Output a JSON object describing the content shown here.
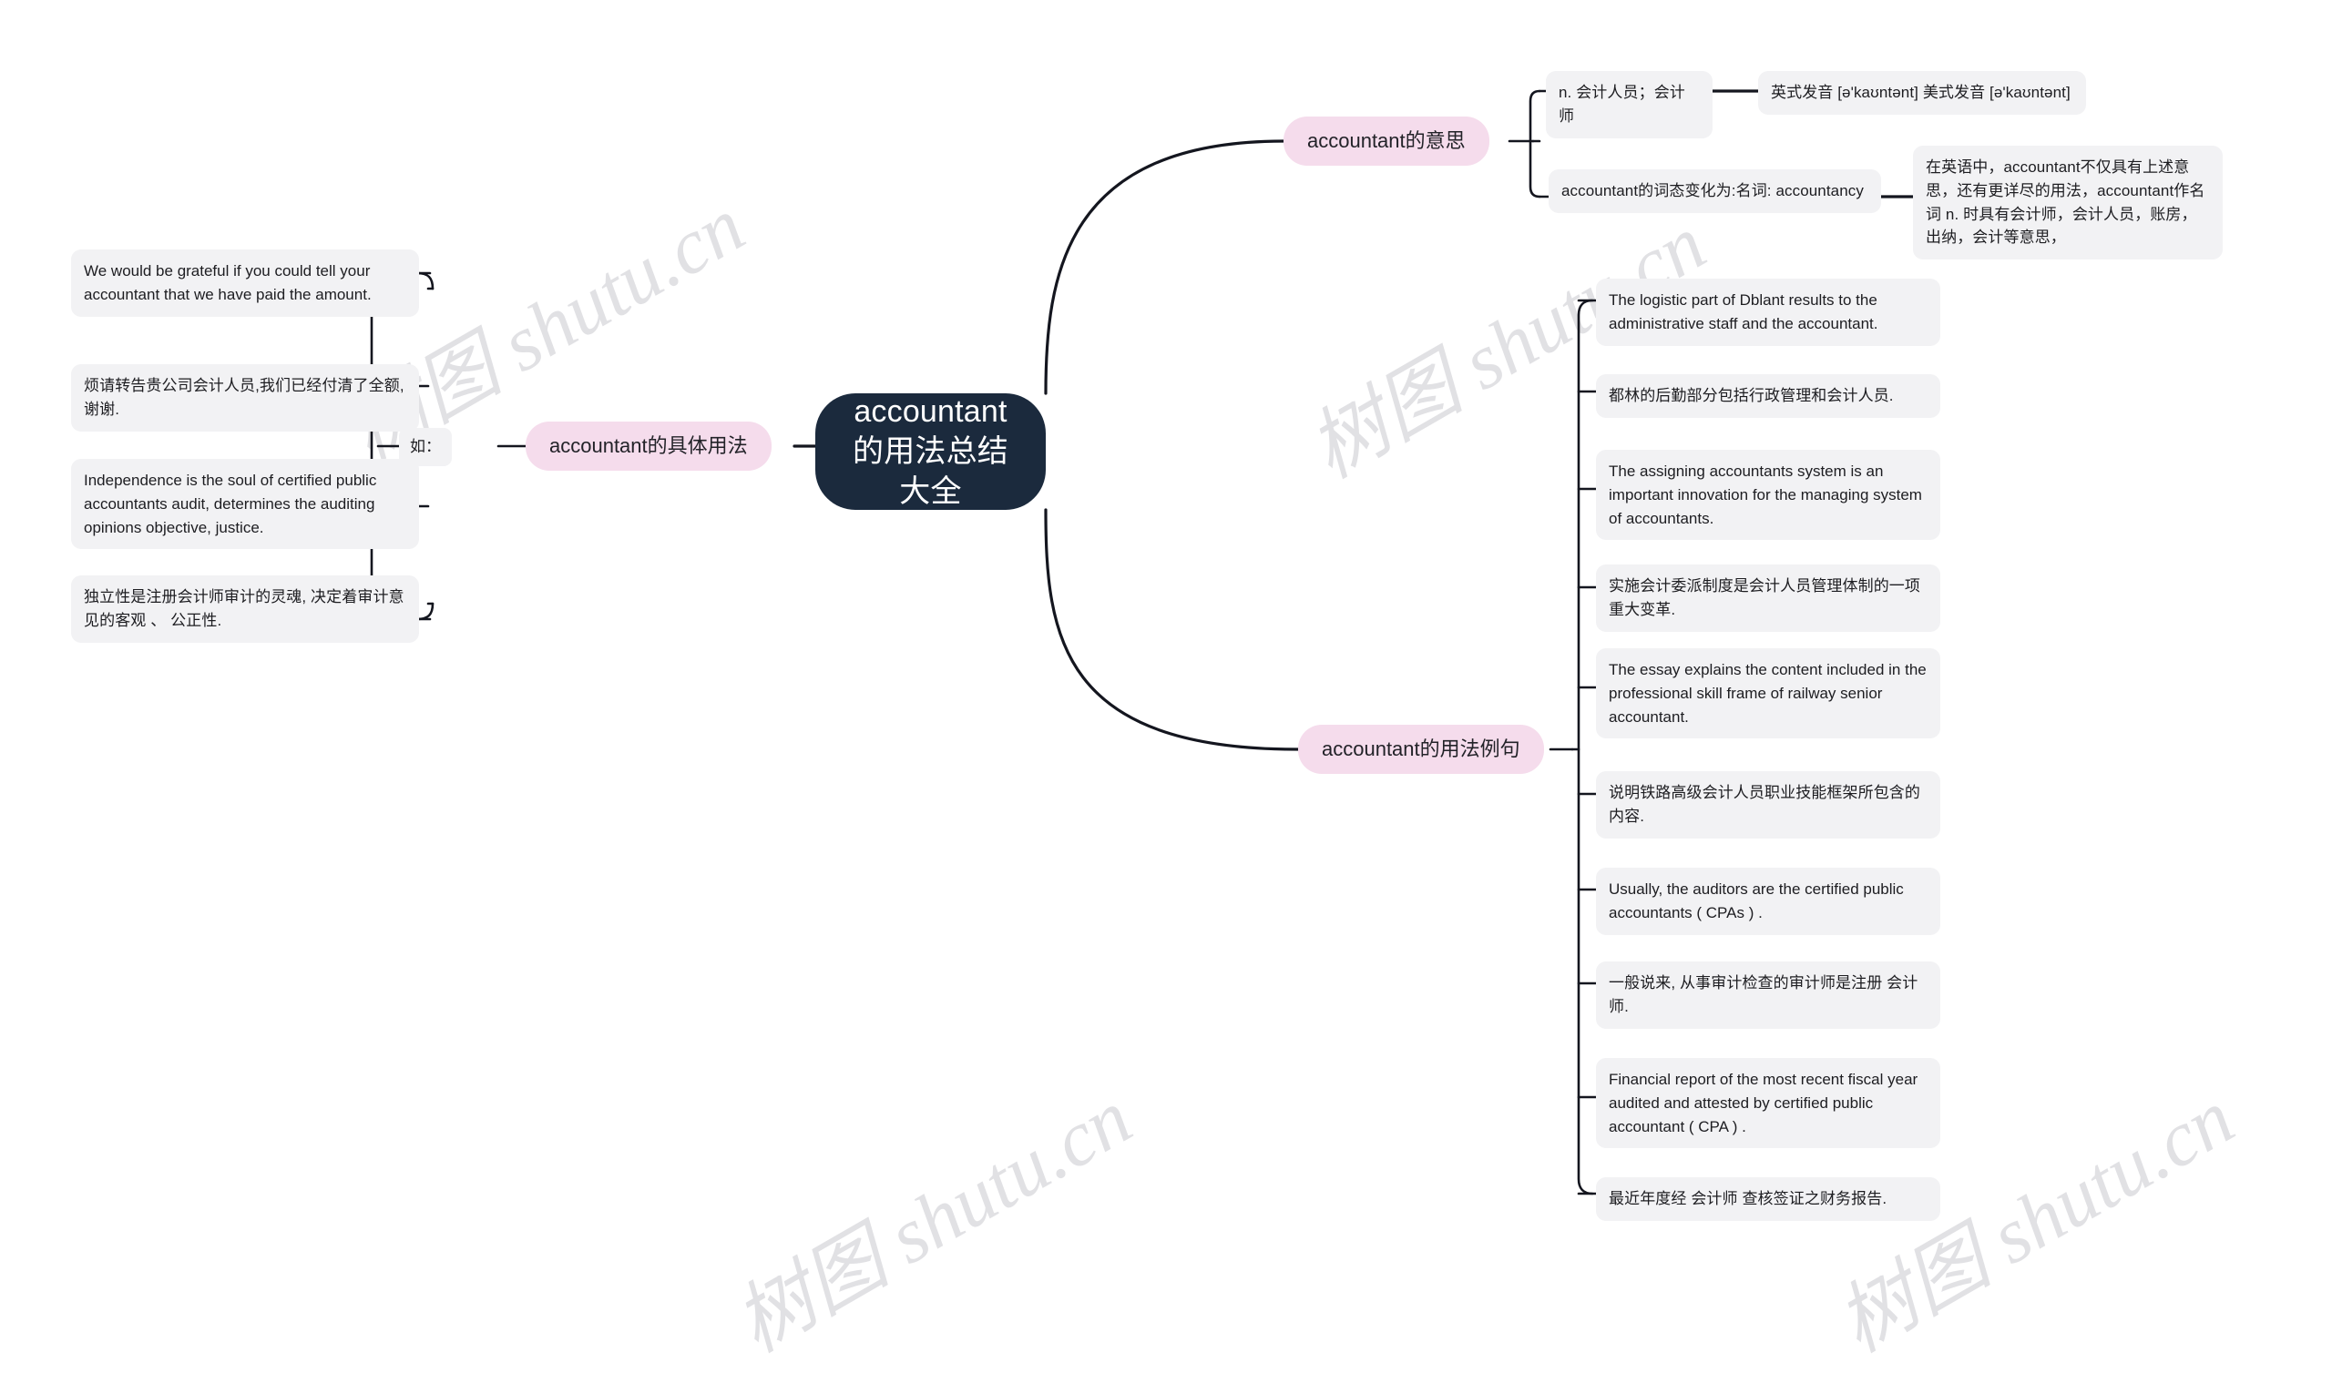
{
  "meta": {
    "watermark_text": "树图 shutu.cn",
    "colors": {
      "root_bg": "#1b2a3d",
      "root_text": "#ffffff",
      "branch_bg": "#f5dcec",
      "branch_text": "#222228",
      "leaf_bg": "#f2f2f4",
      "leaf_text": "#1d1d21",
      "link": "#14161f",
      "page_bg": "#ffffff"
    }
  },
  "root": {
    "label": "accountant的用法总结大全"
  },
  "branches": {
    "meaning": {
      "label": "accountant的意思",
      "items": [
        {
          "label": "n. 会计人员；会计师",
          "detail": "英式发音 [ə'kaʊntənt] 美式发音 [ə'kaʊntənt]"
        },
        {
          "label": "accountant的词态变化为:名词: accountancy",
          "detail": "在英语中，accountant不仅具有上述意思，还有更详尽的用法，accountant作名词 n. 时具有会计师，会计人员，账房，出纳，会计等意思，"
        }
      ]
    },
    "usage": {
      "label": "accountant的具体用法",
      "connector_label": "如：",
      "items": [
        "We would be grateful if you could tell your accountant that we have paid the amount.",
        "烦请转告贵公司会计人员,我们已经付清了全额,谢谢.",
        "Independence is the soul of certified public accountants audit, determines the auditing opinions objective, justice.",
        "独立性是注册会计师审计的灵魂, 决定着审计意见的客观 、 公正性."
      ]
    },
    "examples": {
      "label": "accountant的用法例句",
      "items": [
        "The logistic part of Dblant results to the administrative staff and the accountant.",
        "都林的后勤部分包括行政管理和会计人员.",
        "The assigning accountants system is an important innovation for the managing system of accountants.",
        "实施会计委派制度是会计人员管理体制的一项重大变革.",
        "The essay explains the content included in the professional skill frame of railway senior accountant.",
        "说明铁路高级会计人员职业技能框架所包含的内容.",
        "Usually, the auditors are the certified public accountants ( CPAs ) .",
        "一般说来, 从事审计检查的审计师是注册 会计师.",
        "Financial report of the most recent fiscal year audited and attested by certified public accountant ( CPA ) .",
        "最近年度经 会计师 查核签证之财务报告."
      ]
    }
  }
}
